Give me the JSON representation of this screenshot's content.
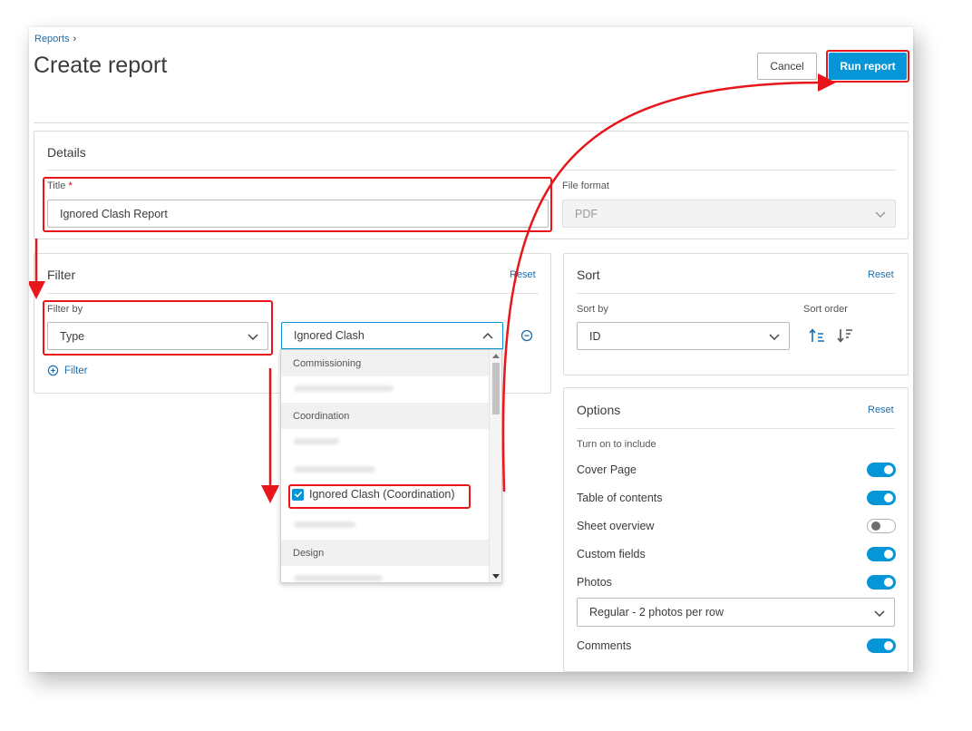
{
  "breadcrumb": {
    "parent": "Reports"
  },
  "page": {
    "title": "Create report"
  },
  "actions": {
    "cancel": "Cancel",
    "run": "Run report"
  },
  "details": {
    "heading": "Details",
    "title_label": "Title",
    "required_mark": "*",
    "title_value": "Ignored Clash Report",
    "format_label": "File format",
    "format_value": "PDF"
  },
  "filter": {
    "heading": "Filter",
    "reset": "Reset",
    "filter_by_label": "Filter by",
    "filter_by_value": "Type",
    "type_value": "Ignored Clash",
    "add_filter": "Filter",
    "dropdown": {
      "groups": [
        "Commissioning",
        "Coordination",
        "Design"
      ],
      "checked_item": "Ignored Clash (Coordination)"
    }
  },
  "sort": {
    "heading": "Sort",
    "reset": "Reset",
    "sort_by_label": "Sort by",
    "sort_by_value": "ID",
    "sort_order_label": "Sort order"
  },
  "options": {
    "heading": "Options",
    "reset": "Reset",
    "hint": "Turn on to include",
    "items": [
      {
        "label": "Cover Page",
        "on": true
      },
      {
        "label": "Table of contents",
        "on": true
      },
      {
        "label": "Sheet overview",
        "on": false
      },
      {
        "label": "Custom fields",
        "on": true
      },
      {
        "label": "Photos",
        "on": true
      }
    ],
    "photo_layout": "Regular - 2 photos per row",
    "comments": {
      "label": "Comments",
      "on": true
    }
  },
  "colors": {
    "accent": "#0696d7",
    "callout": "#e8161b",
    "link": "#1b6eaf"
  }
}
